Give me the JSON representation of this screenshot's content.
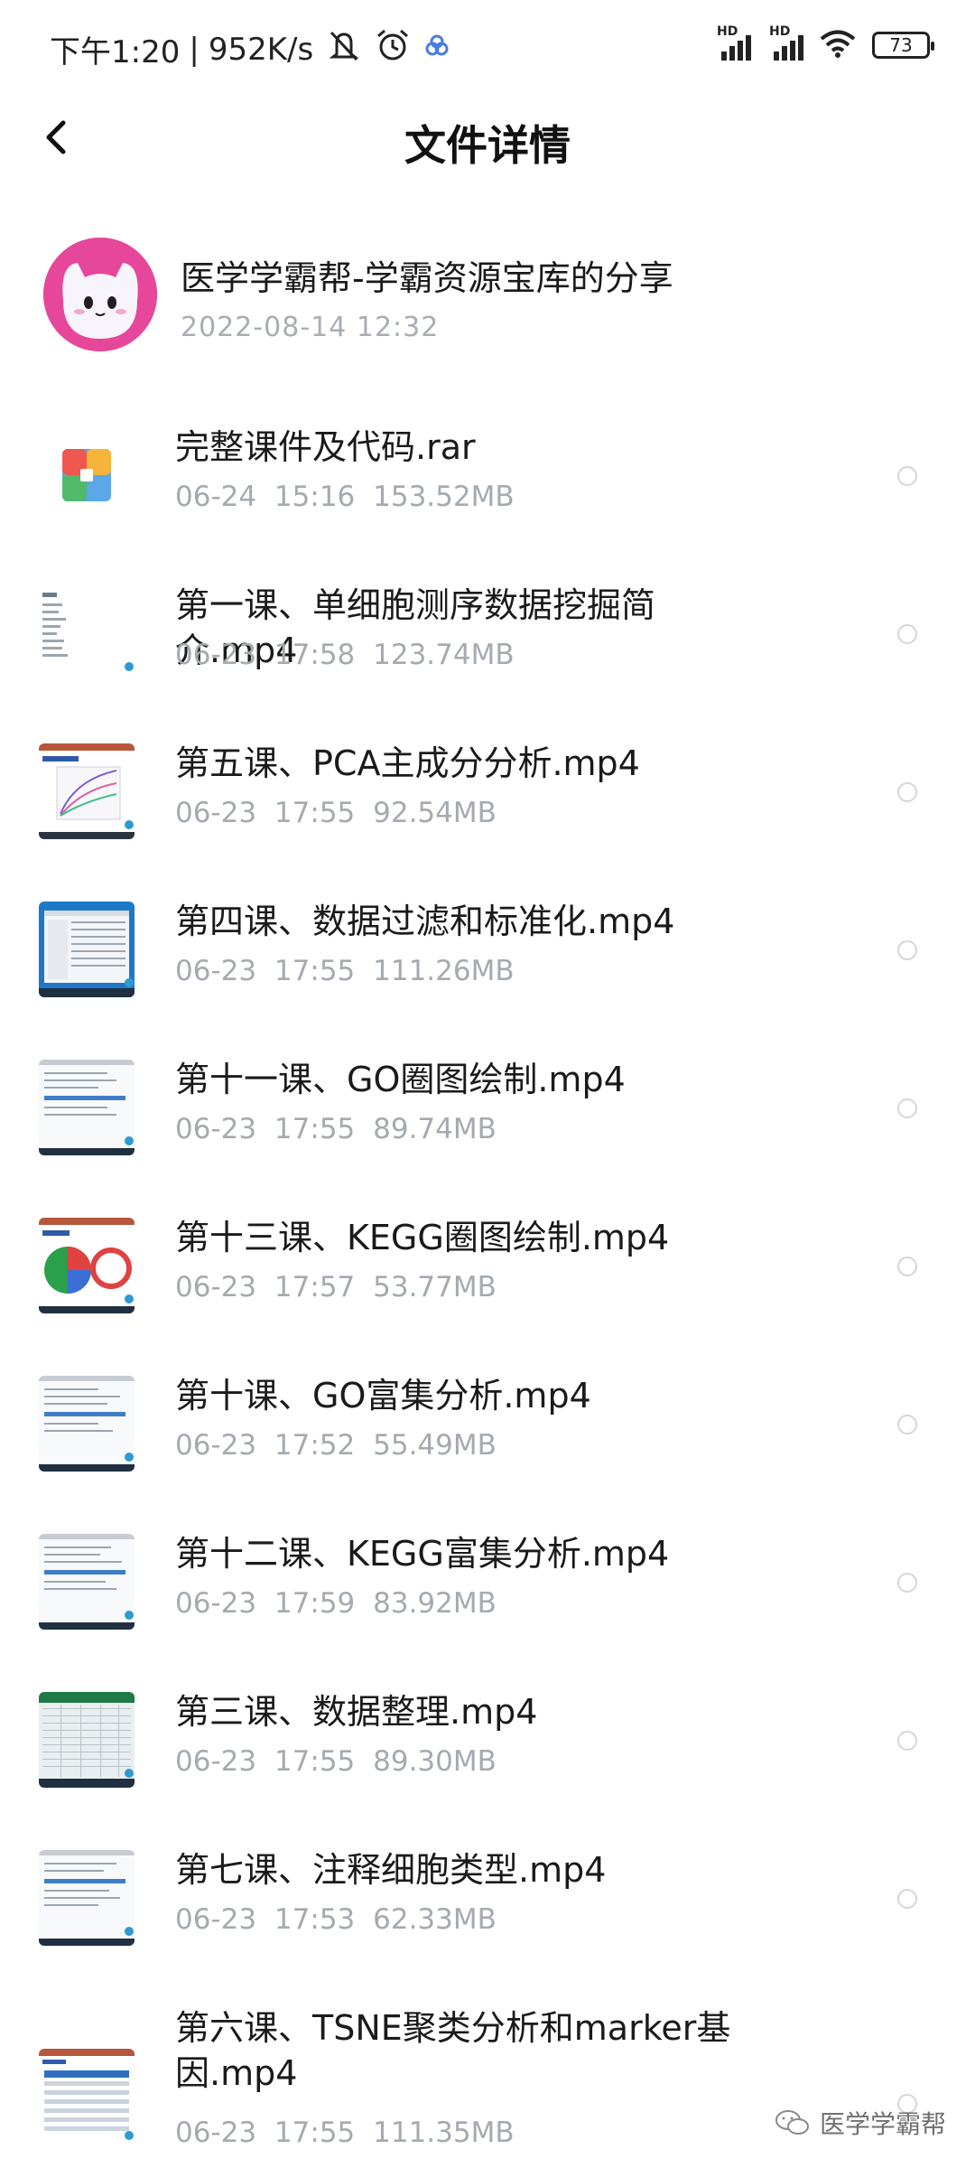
{
  "status_bar": {
    "time": "下午1:20",
    "speed": "952K/s",
    "battery": "73",
    "hd_label": "HD",
    "icons": [
      "mute-icon",
      "alarm-icon",
      "app-notification-icon",
      "signal-icon",
      "signal-icon",
      "wifi-icon",
      "battery-icon"
    ]
  },
  "header": {
    "title": "文件详情",
    "back_icon": "chevron-left-icon"
  },
  "share": {
    "title": "医学学霸帮-学霸资源宝库的分享",
    "date": "2022-08-14  12:32"
  },
  "files": [
    {
      "name": "完整课件及代码.rar",
      "meta": "06-24 15:16 153.52MB",
      "thumb": "archive"
    },
    {
      "name": "第一课、单细胞测序数据挖掘简介.mp4",
      "meta": "06-23 17:58 123.74MB",
      "thumb": "doc"
    },
    {
      "name": "第五课、PCA主成分分析.mp4",
      "meta": "06-23 17:55 92.54MB",
      "thumb": "slide"
    },
    {
      "name": "第四课、数据过滤和标准化.mp4",
      "meta": "06-23 17:55 111.26MB",
      "thumb": "screen"
    },
    {
      "name": "第十一课、GO圈图绘制.mp4",
      "meta": "06-23 17:55 89.74MB",
      "thumb": "web"
    },
    {
      "name": "第十三课、KEGG圈图绘制.mp4",
      "meta": "06-23 17:57 53.77MB",
      "thumb": "chart"
    },
    {
      "name": "第十课、GO富集分析.mp4",
      "meta": "06-23 17:52 55.49MB",
      "thumb": "web"
    },
    {
      "name": "第十二课、KEGG富集分析.mp4",
      "meta": "06-23 17:59 83.92MB",
      "thumb": "web"
    },
    {
      "name": "第三课、数据整理.mp4",
      "meta": "06-23 17:55 89.30MB",
      "thumb": "sheet"
    },
    {
      "name": "第七课、注释细胞类型.mp4",
      "meta": "06-23 17:53 62.33MB",
      "thumb": "web"
    },
    {
      "name": "第六课、TSNE聚类分析和marker基因.mp4",
      "meta": "06-23 17:55 111.35MB",
      "thumb": "table"
    }
  ],
  "watermark": "医学学霸帮"
}
